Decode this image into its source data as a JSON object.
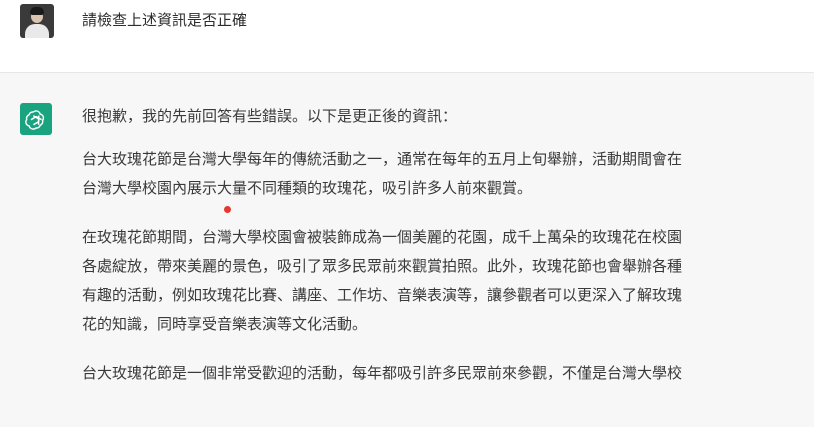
{
  "user_message": {
    "text": "請檢查上述資訊是否正確"
  },
  "assistant_message": {
    "intro": "很抱歉，我的先前回答有些錯誤。以下是更正後的資訊：",
    "paragraphs": [
      {
        "lines": [
          "台大玫瑰花節是台灣大學每年的傳統活動之一，通常在每年的五月上旬舉辦，活動期間會在",
          "台灣大學校園內展示大量不同種類的玫瑰花，吸引許多人前來觀賞。"
        ]
      },
      {
        "lines": [
          "在玫瑰花節期間，台灣大學校園會被裝飾成為一個美麗的花園，成千上萬朵的玫瑰花在校園",
          "各處綻放，帶來美麗的景色，吸引了眾多民眾前來觀賞拍照。此外，玫瑰花節也會舉辦各種",
          "有趣的活動，例如玫瑰花比賽、講座、工作坊、音樂表演等，讓參觀者可以更深入了解玫瑰",
          "花的知識，同時享受音樂表演等文化活動。"
        ]
      },
      {
        "lines": [
          "台大玫瑰花節是一個非常受歡迎的活動，每年都吸引許多民眾前來參觀，不僅是台灣大學校"
        ]
      }
    ]
  },
  "colors": {
    "assistant_bg": "#f7f7f8",
    "bot_avatar": "#19a37f",
    "cursor_marker": "#e5382e"
  },
  "icons": {
    "user_avatar": "user-photo-avatar",
    "bot_avatar": "openai-logo-icon"
  }
}
